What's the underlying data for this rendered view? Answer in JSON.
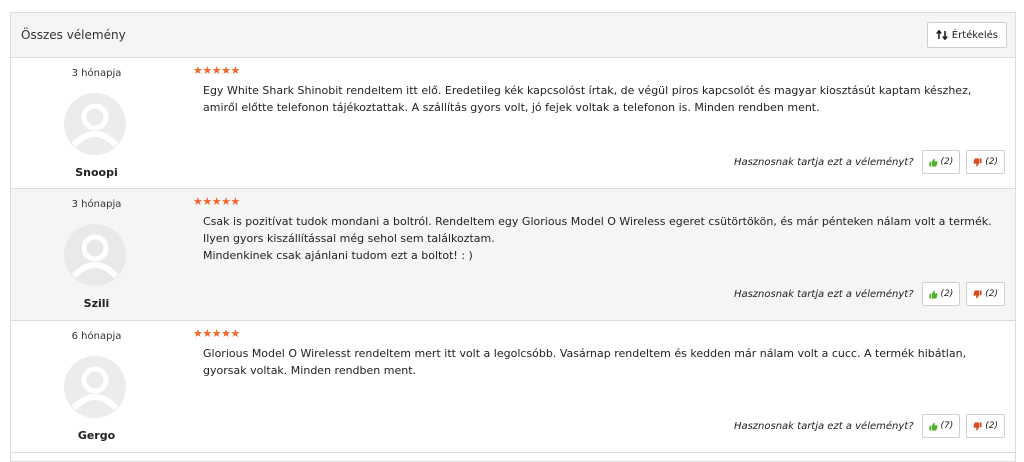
{
  "header": {
    "title": "Összes vélemény",
    "sort_label": "Értékelés"
  },
  "helpful_question": "Hasznosnak tartja ezt a véleményt?",
  "colors": {
    "star": "#f0662a",
    "thumb_up": "#4caf28",
    "thumb_down": "#d84a1b"
  },
  "reviews": [
    {
      "date": "3 hónapja",
      "name": "Snoopi",
      "stars": "★★★★★",
      "rating": 5,
      "lines": [
        "Egy White Shark Shinobit rendeltem itt elő. Eredetileg kék kapcsolóst írtak, de végül piros kapcsolót és magyar kiosztásút kaptam készhez, amiről előtte telefonon tájékoztattak. A szállítás gyors volt, jó fejek voltak a telefonon is. Minden rendben ment."
      ],
      "likes": "(2)",
      "dislikes": "(2)"
    },
    {
      "date": "3 hónapja",
      "name": "Szili",
      "stars": "★★★★★",
      "rating": 5,
      "lines": [
        "Csak is pozitívat tudok mondani a boltról. Rendeltem egy Glorious Model O Wireless egeret csütörtökön, és már pénteken nálam volt a termék. Ilyen gyors kiszállítással még sehol sem találkoztam.",
        "Mindenkinek csak ajánlani tudom ezt a boltot! : )"
      ],
      "likes": "(2)",
      "dislikes": "(2)"
    },
    {
      "date": "6 hónapja",
      "name": "Gergo",
      "stars": "★★★★★",
      "rating": 5,
      "lines": [
        "Glorious Model O Wirelesst rendeltem mert itt volt a legolcsóbb. Vasárnap rendeltem és kedden már nálam volt a cucc. A termék hibátlan, gyorsak voltak. Minden rendben ment."
      ],
      "likes": "(7)",
      "dislikes": "(2)"
    }
  ]
}
